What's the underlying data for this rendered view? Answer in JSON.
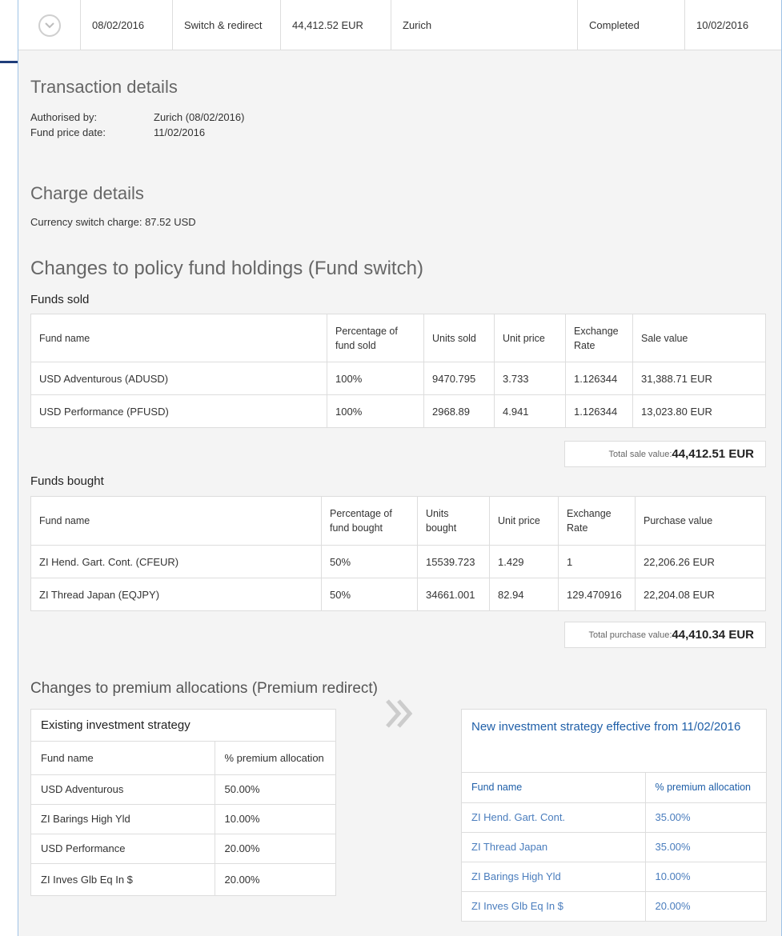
{
  "summary": {
    "date": "08/02/2016",
    "type": "Switch & redirect",
    "amount": "44,412.52 EUR",
    "authoriser": "Zurich",
    "status": "Completed",
    "completed_date": "10/02/2016"
  },
  "transaction": {
    "heading": "Transaction details",
    "authorised_label": "Authorised by:",
    "authorised_value": "Zurich (08/02/2016)",
    "price_date_label": "Fund price date:",
    "price_date_value": "11/02/2016"
  },
  "charge": {
    "heading": "Charge details",
    "label": "Currency switch charge:",
    "value": "87.52 USD"
  },
  "holdings": {
    "heading": "Changes to policy fund holdings (Fund switch)",
    "sold": {
      "subheading": "Funds sold",
      "columns": [
        "Fund name",
        "Percentage of fund sold",
        "Units sold",
        "Unit price",
        "Exchange Rate",
        "Sale value"
      ],
      "rows": [
        [
          "USD Adventurous (ADUSD)",
          "100%",
          "9470.795",
          "3.733",
          "1.126344",
          "31,388.71 EUR"
        ],
        [
          "USD Performance (PFUSD)",
          "100%",
          "2968.89",
          "4.941",
          "1.126344",
          "13,023.80 EUR"
        ]
      ],
      "total_label": "Total sale value:",
      "total_value": "44,412.51 EUR"
    },
    "bought": {
      "subheading": "Funds bought",
      "columns": [
        "Fund name",
        "Percentage of fund bought",
        "Units bought",
        "Unit price",
        "Exchange Rate",
        "Purchase value"
      ],
      "rows": [
        [
          "ZI Hend. Gart. Cont. (CFEUR)",
          "50%",
          "15539.723",
          "1.429",
          "1",
          "22,206.26 EUR"
        ],
        [
          "ZI Thread Japan (EQJPY)",
          "50%",
          "34661.001",
          "82.94",
          "129.470916",
          "22,204.08 EUR"
        ]
      ],
      "total_label": "Total purchase value:",
      "total_value": "44,410.34 EUR"
    }
  },
  "allocations": {
    "heading": "Changes to premium allocations (Premium redirect)",
    "existing": {
      "title": "Existing investment strategy",
      "columns": [
        "Fund name",
        "% premium allocation"
      ],
      "rows": [
        [
          "USD Adventurous",
          "50.00%"
        ],
        [
          "ZI Barings High Yld",
          "10.00%"
        ],
        [
          "USD Performance",
          "20.00%"
        ],
        [
          "ZI Inves Glb Eq In $",
          "20.00%"
        ]
      ]
    },
    "new": {
      "title": "New investment strategy effective from 11/02/2016",
      "columns": [
        "Fund name",
        "% premium allocation"
      ],
      "rows": [
        [
          "ZI Hend. Gart. Cont.",
          "35.00%"
        ],
        [
          "ZI Thread Japan",
          "35.00%"
        ],
        [
          "ZI Barings High Yld",
          "10.00%"
        ],
        [
          "ZI Inves Glb Eq In $",
          "20.00%"
        ]
      ]
    }
  },
  "icons": {
    "toggle": "chevron-down-circle-icon",
    "arrow": "double-chevron-right-icon"
  },
  "colors": {
    "accent": "#1f3d7a",
    "panel_border": "#9fc3e6",
    "link_blue": "#1f5fa8"
  }
}
